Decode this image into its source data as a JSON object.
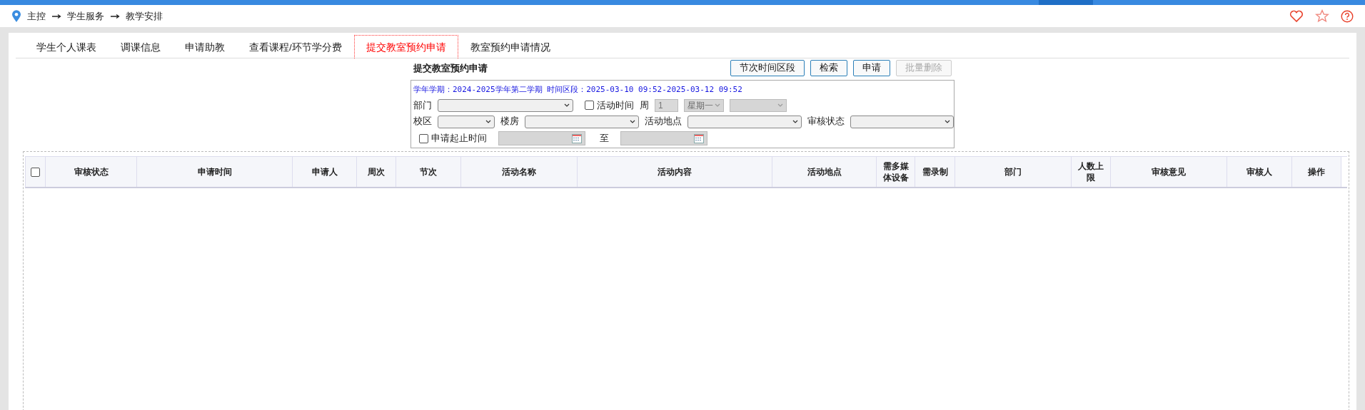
{
  "breadcrumb": [
    "主控",
    "学生服务",
    "教学安排"
  ],
  "tabs": [
    {
      "label": "学生个人课表",
      "selected": false
    },
    {
      "label": "调课信息",
      "selected": false
    },
    {
      "label": "申请助教",
      "selected": false
    },
    {
      "label": "查看课程/环节学分费",
      "selected": false
    },
    {
      "label": "提交教室预约申请",
      "selected": true
    },
    {
      "label": "教室预约申请情况",
      "selected": false
    }
  ],
  "form": {
    "title": "提交教室预约申请",
    "buttons": [
      {
        "label": "节次时间区段",
        "disabled": false
      },
      {
        "label": "检索",
        "disabled": false
      },
      {
        "label": "申请",
        "disabled": false
      },
      {
        "label": "批量删除",
        "disabled": true
      }
    ],
    "info": "学年学期：2024-2025学年第二学期 时间区段：2025-03-10 09:52-2025-03-12 09:52",
    "rows": [
      [
        {
          "kind": "label",
          "text": "部门"
        },
        {
          "kind": "select",
          "disabled": false
        },
        {
          "kind": "checkbox",
          "text": "活动时间",
          "checked": false
        },
        {
          "kind": "label",
          "text": "周"
        },
        {
          "kind": "input",
          "value": "1",
          "disabled": true
        },
        {
          "kind": "select",
          "value": "星期一",
          "disabled": true
        },
        {
          "kind": "select",
          "disabled": true
        }
      ],
      [
        {
          "kind": "label",
          "text": "校区"
        },
        {
          "kind": "select",
          "disabled": false
        },
        {
          "kind": "label",
          "text": "楼房"
        },
        {
          "kind": "select",
          "disabled": false
        },
        {
          "kind": "label",
          "text": "活动地点"
        },
        {
          "kind": "select",
          "disabled": false
        },
        {
          "kind": "label",
          "text": "审核状态"
        },
        {
          "kind": "select",
          "disabled": false
        }
      ],
      [
        {
          "kind": "checkbox",
          "text": "申请起止时间",
          "checked": false
        },
        {
          "kind": "date",
          "disabled": true
        },
        {
          "kind": "label",
          "text": "至"
        },
        {
          "kind": "date",
          "disabled": true
        }
      ]
    ]
  },
  "table": {
    "select_all_checked": false,
    "columns": [
      "审核状态",
      "申请时间",
      "申请人",
      "周次",
      "节次",
      "活动名称",
      "活动内容",
      "活动地点",
      "需多媒体设备",
      "需录制",
      "部门",
      "人数上限",
      "审核意见",
      "审核人",
      "操作"
    ]
  }
}
